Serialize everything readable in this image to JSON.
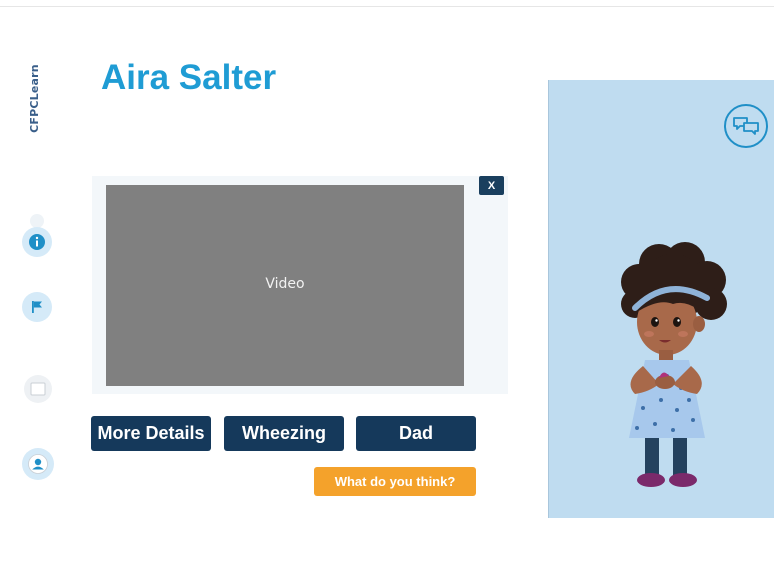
{
  "logo": {
    "text": "CFPCLearn"
  },
  "patient": {
    "name": "Aira Salter"
  },
  "video": {
    "label": "Video",
    "close_label": "X"
  },
  "buttons": {
    "more_details": "More Details",
    "wheezing": "Wheezing",
    "dad": "Dad",
    "what_do_you_think": "What do you think?"
  },
  "sidebar": {
    "icons": [
      "info-icon",
      "flag-icon",
      "notes-icon",
      "user-icon"
    ]
  },
  "right_panel": {
    "chat_icon": "chat-bubbles-icon",
    "character": "child-patient-illustration"
  },
  "colors": {
    "title": "#1f9cd4",
    "button": "#15395b",
    "accent_button": "#f4a22b",
    "panel": "#bfdcf0",
    "video": "#808080"
  }
}
